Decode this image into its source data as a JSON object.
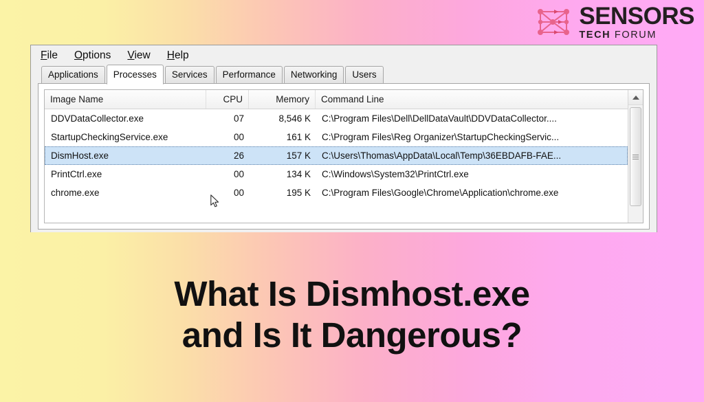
{
  "brand": {
    "icon": "network-nodes-icon",
    "name": "SENSORS",
    "tagline_bold": "TECH",
    "tagline_light": "FORUM",
    "accent_color": "#e8638c",
    "text_color": "#231f20"
  },
  "background": {
    "gradient_from": "#fbf3a6",
    "gradient_to": "#ffaaf6"
  },
  "window": {
    "menu": [
      {
        "label": "File",
        "accel": "F"
      },
      {
        "label": "Options",
        "accel": "O"
      },
      {
        "label": "View",
        "accel": "V"
      },
      {
        "label": "Help",
        "accel": "H"
      }
    ],
    "tabs": [
      {
        "label": "Applications",
        "active": false
      },
      {
        "label": "Processes",
        "active": true
      },
      {
        "label": "Services",
        "active": false
      },
      {
        "label": "Performance",
        "active": false
      },
      {
        "label": "Networking",
        "active": false
      },
      {
        "label": "Users",
        "active": false
      }
    ],
    "columns": [
      "Image Name",
      "CPU",
      "Memory",
      "Command Line"
    ],
    "rows": [
      {
        "image_name": "DDVDataCollector.exe",
        "cpu": "07",
        "memory": "8,546 K",
        "command_line": "C:\\Program Files\\Dell\\DellDataVault\\DDVDataCollector....",
        "selected": false
      },
      {
        "image_name": "StartupCheckingService.exe",
        "cpu": "00",
        "memory": "161 K",
        "command_line": "C:\\Program Files\\Reg Organizer\\StartupCheckingServic...",
        "selected": false
      },
      {
        "image_name": "DismHost.exe",
        "cpu": "26",
        "memory": "157 K",
        "command_line": "C:\\Users\\Thomas\\AppData\\Local\\Temp\\36EBDAFB-FAE...",
        "selected": true
      },
      {
        "image_name": "PrintCtrl.exe",
        "cpu": "00",
        "memory": "134 K",
        "command_line": "C:\\Windows\\System32\\PrintCtrl.exe",
        "selected": false
      },
      {
        "image_name": "chrome.exe",
        "cpu": "00",
        "memory": "195 K",
        "command_line": "C:\\Program Files\\Google\\Chrome\\Application\\chrome.exe",
        "selected": false
      }
    ],
    "scrollbar": {
      "up_button": "scroll-up-arrow-icon"
    },
    "selection_color": "#cde3f7"
  },
  "headline": {
    "line1": "What Is Dismhost.exe",
    "line2": "and Is It Dangerous?"
  }
}
